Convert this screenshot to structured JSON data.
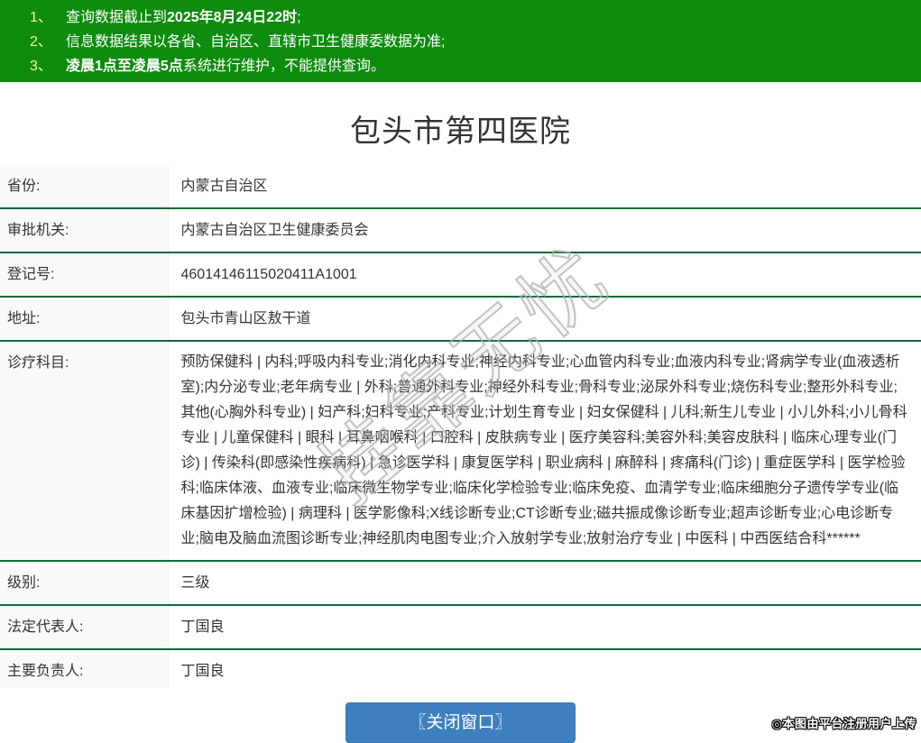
{
  "notice": {
    "items": [
      {
        "num": "1、",
        "pre": "查询数据截止到",
        "bold": "2025年8月24日22时",
        "post": ";"
      },
      {
        "num": "2、",
        "pre": "信息数据结果以各省、自治区、直辖市卫生健康委数据为准;",
        "bold": "",
        "post": ""
      },
      {
        "num": "3、",
        "pre": "",
        "bold": "凌晨1点至凌晨5点",
        "post": "系统进行维护，不能提供查询。"
      }
    ]
  },
  "title": "包头市第四医院",
  "fields": {
    "rows": [
      {
        "label": "省份:",
        "value": "内蒙古自治区"
      },
      {
        "label": "审批机关:",
        "value": "内蒙古自治区卫生健康委员会"
      },
      {
        "label": "登记号:",
        "value": "46014146115020411A1001"
      },
      {
        "label": "地址:",
        "value": "包头市青山区敖干道"
      },
      {
        "label": "诊疗科目:",
        "value": "预防保健科 | 内科;呼吸内科专业;消化内科专业;神经内科专业;心血管内科专业;血液内科专业;肾病学专业(血液透析室);内分泌专业;老年病专业 | 外科;普通外科专业;神经外科专业;骨科专业;泌尿外科专业;烧伤科专业;整形外科专业;其他(心胸外科专业) | 妇产科;妇科专业;产科专业;计划生育专业 | 妇女保健科 | 儿科;新生儿专业 | 小儿外科;小儿骨科专业 | 儿童保健科 | 眼科 | 耳鼻咽喉科 | 口腔科 | 皮肤病专业 | 医疗美容科;美容外科;美容皮肤科 | 临床心理专业(门诊) | 传染科(即感染性疾病科) | 急诊医学科 | 康复医学科 | 职业病科 | 麻醉科 | 疼痛科(门诊) | 重症医学科 | 医学检验科;临床体液、血液专业;临床微生物学专业;临床化学检验专业;临床免疫、血清学专业;临床细胞分子遗传学专业(临床基因扩增检验) | 病理科 | 医学影像科;X线诊断专业;CT诊断专业;磁共振成像诊断专业;超声诊断专业;心电诊断专业;脑电及脑血流图诊断专业;神经肌肉电图专业;介入放射学专业;放射治疗专业 | 中医科 | 中西医结合科******"
      },
      {
        "label": "级别:",
        "value": "三级"
      },
      {
        "label": "法定代表人:",
        "value": "丁国良"
      },
      {
        "label": "主要负责人:",
        "value": "丁国良"
      }
    ]
  },
  "button": {
    "label": "〖关闭窗口〗"
  },
  "watermark": {
    "diagonal": "挂靠无忧",
    "footer": "◎本图由平台注册用户上传"
  },
  "colors": {
    "banner_green": "#0e8c0e",
    "row_divider_green": "#0e6b3d",
    "label_bg": "#f9f9f9",
    "button_blue": "#3d80bd",
    "notice_number_yellow": "#f8f3a6",
    "text": "#333333"
  }
}
